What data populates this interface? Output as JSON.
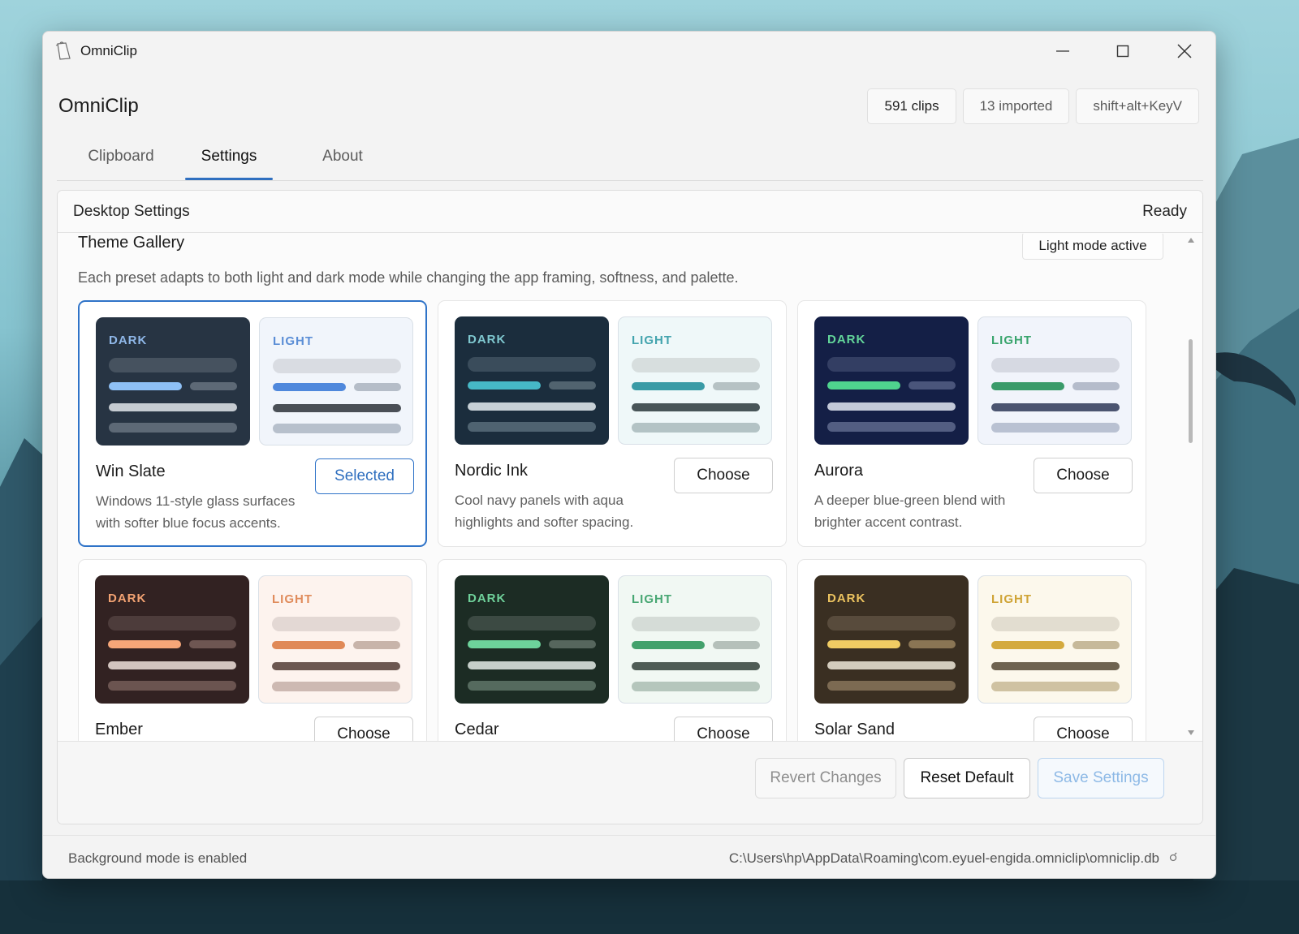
{
  "window": {
    "title": "OmniClip",
    "minimize_icon": "minimize-icon",
    "maximize_icon": "maximize-icon",
    "close_icon": "close-icon"
  },
  "header": {
    "app_name": "OmniClip",
    "stats": [
      {
        "label": "591 clips"
      },
      {
        "label": "13 imported"
      },
      {
        "label": "shift+alt+KeyV"
      }
    ]
  },
  "tabs": [
    {
      "label": "Clipboard",
      "active": false
    },
    {
      "label": "Settings",
      "active": true
    },
    {
      "label": "About",
      "active": false
    }
  ],
  "panel": {
    "title": "Desktop Settings",
    "status": "Ready"
  },
  "gallery": {
    "title": "Theme Gallery",
    "mode_badge": "Light mode active",
    "description": "Each preset adapts to both light and dark mode while changing the app framing, softness, and palette.",
    "dark_label": "DARK",
    "light_label": "LIGHT",
    "themes": [
      {
        "name": "Win Slate",
        "description": "Windows 11-style glass surfaces with softer blue focus accents.",
        "button": "Selected",
        "selected": true,
        "dark": {
          "bg": "#273443",
          "label": "#8fb7e8",
          "line": "#46525f",
          "accent": "#8ec0f5",
          "muted": "#5d6976",
          "bright": "#c5cbd1",
          "soft": "#5d6976"
        },
        "light": {
          "bg": "#f1f5fb",
          "label": "#5b8ed6",
          "line": "#d9dce2",
          "accent": "#4f88dc",
          "muted": "#b5bdc8",
          "bright": "#4a4f56",
          "soft": "#b7c0cc"
        }
      },
      {
        "name": "Nordic Ink",
        "description": "Cool navy panels with aqua highlights and softer spacing.",
        "button": "Choose",
        "selected": false,
        "dark": {
          "bg": "#1b2d3d",
          "label": "#7fc8d0",
          "line": "#3a4c5b",
          "accent": "#46b8c6",
          "muted": "#51636f",
          "bright": "#c7d0d6",
          "soft": "#4f6371"
        },
        "light": {
          "bg": "#eff8f9",
          "label": "#43a4ae",
          "line": "#d7dede",
          "accent": "#3a9ba6",
          "muted": "#b6c2c4",
          "bright": "#485558",
          "soft": "#b3c3c5"
        }
      },
      {
        "name": "Aurora",
        "description": "A deeper blue-green blend with brighter accent contrast.",
        "button": "Choose",
        "selected": false,
        "dark": {
          "bg": "#141f46",
          "label": "#63d69a",
          "line": "#333e63",
          "accent": "#4fd38e",
          "muted": "#4a557b",
          "bright": "#c3c9d8",
          "soft": "#535e82"
        },
        "light": {
          "bg": "#f1f4fb",
          "label": "#39a46d",
          "line": "#d6d9e2",
          "accent": "#3a9b6a",
          "muted": "#b5bccb",
          "bright": "#4b5470",
          "soft": "#b9c1d2"
        }
      },
      {
        "name": "Ember",
        "description": "",
        "button": "Choose",
        "selected": false,
        "dark": {
          "bg": "#322222",
          "label": "#f2a272",
          "line": "#4d3c3b",
          "accent": "#f6a678",
          "muted": "#6e5652",
          "bright": "#d2c4bf",
          "soft": "#6b5450"
        },
        "light": {
          "bg": "#fdf3ee",
          "label": "#e08c5c",
          "line": "#e3d8d4",
          "accent": "#e08957",
          "muted": "#c8b4aa",
          "bright": "#6c5751",
          "soft": "#cdb9b2"
        }
      },
      {
        "name": "Cedar",
        "description": "",
        "button": "Choose",
        "selected": false,
        "dark": {
          "bg": "#1c2c24",
          "label": "#6fd19a",
          "line": "#3c4a43",
          "accent": "#6dd39b",
          "muted": "#56665d",
          "bright": "#c6cfca",
          "soft": "#556a5e"
        },
        "light": {
          "bg": "#f1f8f3",
          "label": "#48a773",
          "line": "#d5dcd7",
          "accent": "#43a16c",
          "muted": "#b5c0ba",
          "bright": "#4f5c55",
          "soft": "#b5c6bc"
        }
      },
      {
        "name": "Solar Sand",
        "description": "",
        "button": "Choose",
        "selected": false,
        "dark": {
          "bg": "#3a2f22",
          "label": "#ecc35f",
          "line": "#584b3c",
          "accent": "#f1cc63",
          "muted": "#8a7554",
          "bright": "#d3ccbd",
          "soft": "#7c6a52"
        },
        "light": {
          "bg": "#fcf8ec",
          "label": "#cfa436",
          "line": "#e2ddd0",
          "accent": "#d4aa3e",
          "muted": "#c6b99a",
          "bright": "#6e6350",
          "soft": "#cfc2a2"
        }
      }
    ]
  },
  "footer": {
    "revert": "Revert Changes",
    "reset": "Reset Default",
    "save": "Save Settings"
  },
  "status_bar": {
    "left": "Background mode is enabled",
    "right": "C:\\Users\\hp\\AppData\\Roaming\\com.eyuel-engida.omniclip\\omniclip.db"
  },
  "colors": {
    "accent": "#2f73c8",
    "window_bg": "#f3f3f3"
  }
}
